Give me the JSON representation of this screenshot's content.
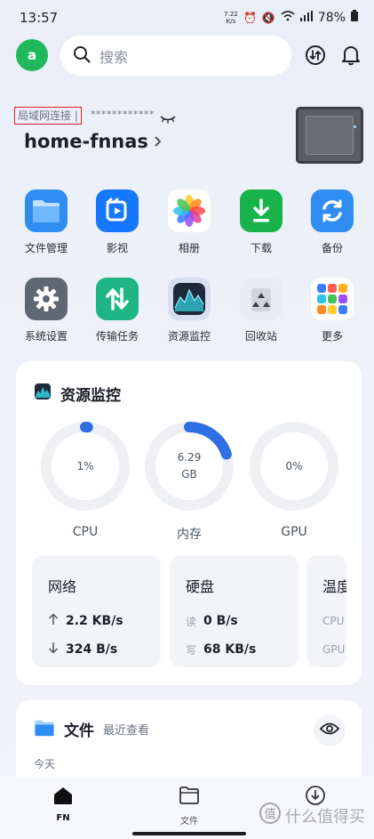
{
  "status": {
    "time": "13:57",
    "net_speed_value": "7.22",
    "net_speed_unit": "K/s",
    "battery": "78%"
  },
  "header": {
    "avatar_letter": "a",
    "search_placeholder": "搜索"
  },
  "device": {
    "lan_label": "局域网连接 |",
    "ip_masked": "************",
    "name": "home-fnnas"
  },
  "apps": [
    {
      "label": "文件管理",
      "icon": "folder-icon",
      "color": "#2f8cf0"
    },
    {
      "label": "影视",
      "icon": "film-icon",
      "color": "#1677ff"
    },
    {
      "label": "相册",
      "icon": "photos-icon",
      "color": "#ffffff"
    },
    {
      "label": "下载",
      "icon": "download-icon",
      "color": "#18b34b"
    },
    {
      "label": "备份",
      "icon": "backup-icon",
      "color": "#2f8cf0"
    },
    {
      "label": "系统设置",
      "icon": "gear-icon",
      "color": "#5f6773"
    },
    {
      "label": "传输任务",
      "icon": "transfer-icon",
      "color": "#1fb585"
    },
    {
      "label": "资源监控",
      "icon": "monitor-icon",
      "color": "#1e2a3a"
    },
    {
      "label": "回收站",
      "icon": "recycle-icon",
      "color": "#e9edf2"
    },
    {
      "label": "更多",
      "icon": "more-apps-icon",
      "color": "#ffffff"
    }
  ],
  "monitor": {
    "title": "资源监控",
    "cpu": {
      "center": "1%",
      "label": "CPU",
      "percent": 1
    },
    "memory": {
      "value": "6.29",
      "unit": "GB",
      "label": "内存",
      "percent": 20
    },
    "gpu": {
      "center": "0%",
      "label": "GPU",
      "percent": 0
    },
    "network": {
      "title": "网络",
      "up": "2.2 KB/s",
      "down": "324 B/s"
    },
    "disk": {
      "title": "硬盘",
      "read_key": "读",
      "read": "0 B/s",
      "write_key": "写",
      "write": "68 KB/s"
    },
    "temp": {
      "title": "温度",
      "k1": "CPU",
      "k2": "GPU"
    }
  },
  "files": {
    "title": "文件",
    "subtitle": "最近查看",
    "today": "今天"
  },
  "nav": {
    "fn": "FN",
    "files": "文件"
  },
  "watermark": "什么值得买",
  "colors": {
    "accent": "#2f6fe4",
    "avatar": "#1fb85c",
    "ring_track": "#eef0f4"
  }
}
